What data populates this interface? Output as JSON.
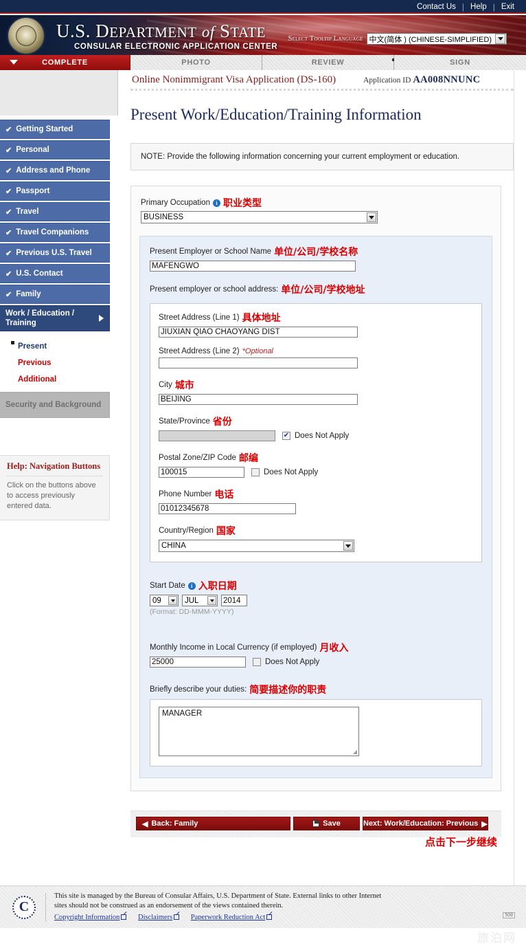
{
  "topbar": {
    "links": [
      "Contact Us",
      "Help",
      "Exit"
    ]
  },
  "banner": {
    "title_line1_a": "U.S. D",
    "title_line1_b": "epartment ",
    "title_line1_it": "of ",
    "title_line1_c": "S",
    "title_line1_d": "tate",
    "title_full": "U.S. DEPARTMENT of STATE",
    "subtitle": "CONSULAR ELECTRONIC APPLICATION CENTER",
    "language_label": "Select Tooltip Language",
    "language_value": "中文(简体 ) (CHINESE-SIMPLIFIED)",
    "seal_alt": "department-of-state-seal"
  },
  "steps": [
    {
      "label": "COMPLETE",
      "active": true
    },
    {
      "label": "PHOTO",
      "active": false
    },
    {
      "label": "REVIEW",
      "active": false
    },
    {
      "label": "SIGN",
      "active": false
    }
  ],
  "sidebar": {
    "items": [
      {
        "label": "Getting Started",
        "state": "done"
      },
      {
        "label": "Personal",
        "state": "done"
      },
      {
        "label": "Address and Phone",
        "state": "done"
      },
      {
        "label": "Passport",
        "state": "done"
      },
      {
        "label": "Travel",
        "state": "done"
      },
      {
        "label": "Travel Companions",
        "state": "done"
      },
      {
        "label": "Previous U.S. Travel",
        "state": "done"
      },
      {
        "label": "U.S. Contact",
        "state": "done"
      },
      {
        "label": "Family",
        "state": "done"
      }
    ],
    "current": {
      "label": "Work / Education / Training"
    },
    "subitems": [
      {
        "label": "Present",
        "selected": true
      },
      {
        "label": "Previous",
        "selected": false
      },
      {
        "label": "Additional",
        "selected": false
      }
    ],
    "disabled": {
      "label": "Security and Background"
    },
    "help": {
      "title": "Help: Navigation Buttons",
      "body": "Click on the buttons above to access previously entered data."
    }
  },
  "header": {
    "form_name": "Online Nonimmigrant Visa Application (DS-160)",
    "app_id_label": "Application ID",
    "app_id_value": "AA008NNUNC"
  },
  "page": {
    "title": "Present Work/Education/Training Information",
    "note": "NOTE: Provide the following information concerning your current employment or education."
  },
  "form": {
    "primary_occupation": {
      "label": "Primary Occupation",
      "annotation": "职业类型",
      "value": "BUSINESS"
    },
    "employer_name": {
      "label": "Present Employer or School Name",
      "annotation": "单位/公司/学校名称",
      "value": "MAFENGWO"
    },
    "address_heading": {
      "label": "Present employer or school address:",
      "annotation": "单位/公司/学校地址"
    },
    "street1": {
      "label": "Street Address (Line 1)",
      "annotation": "具体地址",
      "value": "JIUXIAN QIAO CHAOYANG DIST"
    },
    "street2": {
      "label": "Street Address (Line 2)",
      "optional": "*Optional",
      "value": ""
    },
    "city": {
      "label": "City",
      "annotation": "城市",
      "value": "BEIJING"
    },
    "state": {
      "label": "State/Province",
      "annotation": "省份",
      "value": "",
      "does_not_apply_label": "Does Not Apply",
      "does_not_apply_checked": true
    },
    "postal": {
      "label": "Postal Zone/ZIP Code",
      "annotation": "邮编",
      "value": "100015",
      "does_not_apply_label": "Does Not Apply",
      "does_not_apply_checked": false
    },
    "phone": {
      "label": "Phone Number",
      "annotation": "电话",
      "value": "01012345678"
    },
    "country": {
      "label": "Country/Region",
      "annotation": "国家",
      "value": "CHINA"
    },
    "start_date": {
      "label": "Start Date",
      "annotation": "入职日期",
      "day": "09",
      "month": "JUL",
      "year": "2014",
      "format_hint": "(Format: DD-MMM-YYYY)"
    },
    "income": {
      "label": "Monthly Income in Local Currency (if employed)",
      "annotation": "月收入",
      "value": "25000",
      "does_not_apply_label": "Does Not Apply",
      "does_not_apply_checked": false
    },
    "duties": {
      "label": "Briefly describe your duties:",
      "annotation": "简要描述你的职责",
      "value": "MANAGER"
    }
  },
  "buttons": {
    "back": "Back: Family",
    "save": "Save",
    "next": "Next: Work/Education: Previous",
    "next_annotation": "点击下一步继续"
  },
  "footer": {
    "text_line1": "This site is managed by the Bureau of Consular Affairs, U.S. Department of State. External links to other Internet",
    "text_line2": "sites should not be construed as an endorsement of the views contained therein.",
    "links": [
      "Copyright Information",
      "Disclaimers",
      "Paperwork Reduction Act"
    ],
    "badge": "508",
    "watermark": "旅泊网",
    "seal_letter": "C"
  },
  "colors": {
    "brand_red": "#a61414",
    "brand_navy": "#14294d",
    "nav_blue": "#4d6ba6",
    "nav_blue_active": "#2e4a7d",
    "annotation_red": "#dd0000",
    "link_blue": "#1a35a8"
  }
}
